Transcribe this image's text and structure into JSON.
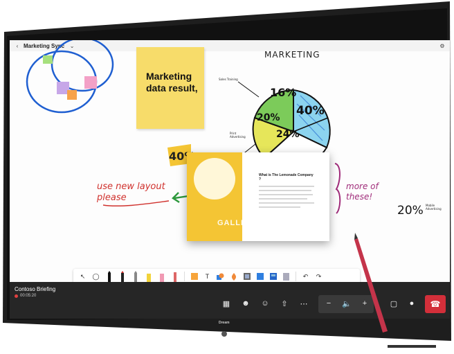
{
  "window": {
    "title": "Marketing Sync"
  },
  "sticky_note": {
    "text": "Marketing data result,"
  },
  "annotations": {
    "marketing_heading": "MARKETING",
    "pie_pct_green": "16%",
    "pie_pct_blue": "40%",
    "pie_pct_yellow": "20%",
    "pie_pct_white": "24%",
    "label_sales_training": "Sales Training",
    "label_print_advertising": "Print Advertising",
    "stamp_40": "40%",
    "use_new_layout": "use new layout please",
    "more_of_these": "more of these!",
    "side_20": "20%",
    "side_20_label": "Mobile Advertising"
  },
  "card": {
    "title": "What is The Lemonade Company ?",
    "overlay": "GALLERY"
  },
  "meeting": {
    "name": "Contoso Briefing",
    "timer": "00:05:20"
  },
  "device": {
    "brand": "Dream"
  },
  "colors": {
    "sticky": "#f7dc6a",
    "card_yellow": "#f4c534",
    "ink_red": "#d0312d",
    "ink_green": "#2f9a3e",
    "ink_blue": "#1f5fd1",
    "ink_purple": "#7a1f6a",
    "hangup": "#d32f3a",
    "meeting_bar": "#262626"
  },
  "toolbar": {
    "tools": [
      "select-arrow",
      "lasso",
      "pen-black",
      "pen-red",
      "pen-grey",
      "highlighter-yellow",
      "eraser-pink",
      "ruler",
      "sticky-note",
      "text",
      "shapes",
      "fill",
      "image",
      "template",
      "layout",
      "page",
      "undo",
      "redo"
    ]
  },
  "controls": {
    "icons": [
      "grid-icon",
      "people-icon",
      "emoji-icon",
      "share-icon",
      "more-icon",
      "minus-icon",
      "speaker-icon",
      "plus-icon",
      "camera-icon",
      "mic-icon",
      "hangup-icon"
    ]
  }
}
